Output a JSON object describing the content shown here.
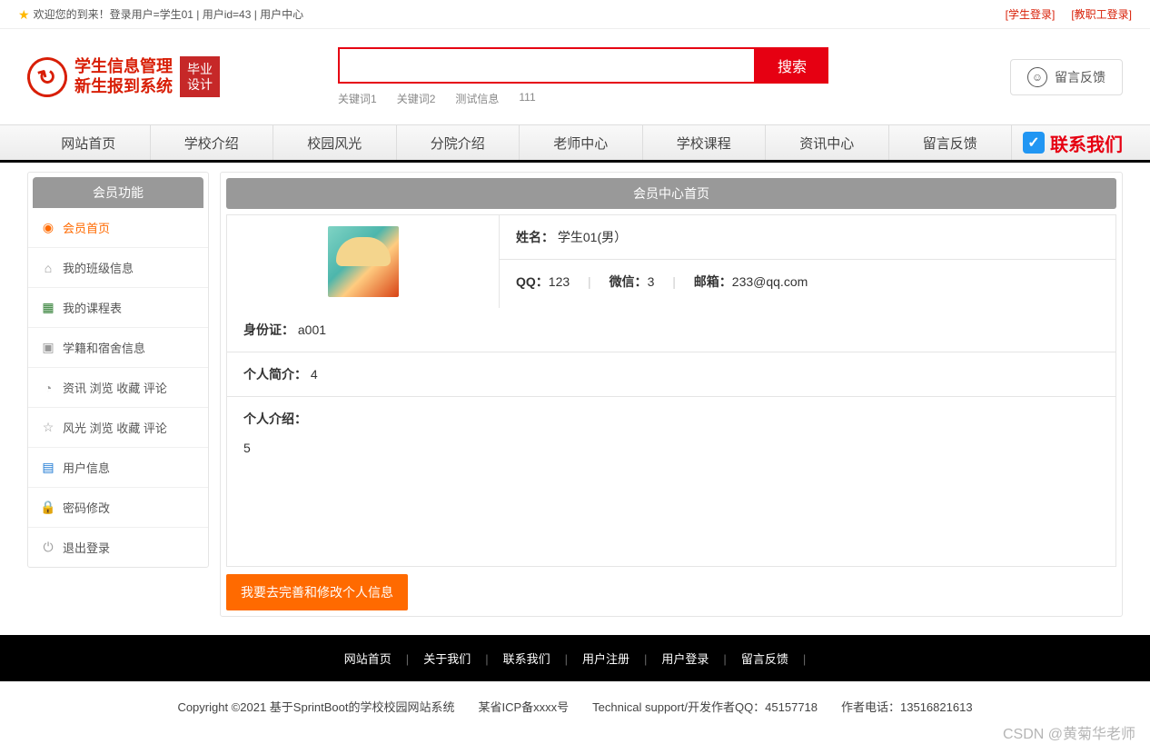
{
  "topbar": {
    "welcome": "欢迎您的到来！登录用户=学生01 | 用户id=43 | 用户中心",
    "student_login": "[学生登录]",
    "staff_login": "[教职工登录]"
  },
  "logo": {
    "line1": "学生信息管理",
    "line2": "新生报到系统",
    "badge_l1": "毕业",
    "badge_l2": "设计"
  },
  "search": {
    "placeholder": "",
    "button": "搜索",
    "keywords": [
      "关键词1",
      "关键词2",
      "测试信息",
      "111"
    ]
  },
  "feedback_btn": "留言反馈",
  "nav": [
    "网站首页",
    "学校介绍",
    "校园风光",
    "分院介绍",
    "老师中心",
    "学校课程",
    "资讯中心",
    "留言反馈"
  ],
  "nav_contact": "联系我们",
  "sidebar": {
    "title": "会员功能",
    "items": [
      {
        "label": "会员首页",
        "icon": "home-icon",
        "color": "ic-orange",
        "glyph": "◉",
        "active": true
      },
      {
        "label": "我的班级信息",
        "icon": "class-icon",
        "color": "ic-gray",
        "glyph": "⌂"
      },
      {
        "label": "我的课程表",
        "icon": "schedule-icon",
        "color": "ic-green",
        "glyph": "▦"
      },
      {
        "label": "学籍和宿舍信息",
        "icon": "dorm-icon",
        "color": "ic-gray",
        "glyph": "▣"
      },
      {
        "label": "资讯 浏览 收藏 评论",
        "icon": "news-icon",
        "color": "ic-gray",
        "glyph": "◔"
      },
      {
        "label": "风光 浏览 收藏 评论",
        "icon": "scenery-icon",
        "color": "ic-gray",
        "glyph": "☆"
      },
      {
        "label": "用户信息",
        "icon": "user-icon",
        "color": "ic-blue",
        "glyph": "▤"
      },
      {
        "label": "密码修改",
        "icon": "password-icon",
        "color": "ic-orange",
        "glyph": "🔒"
      },
      {
        "label": "退出登录",
        "icon": "logout-icon",
        "color": "ic-gray",
        "glyph": "⏻"
      }
    ]
  },
  "content": {
    "title": "会员中心首页",
    "name_label": "姓名：",
    "name_value": "学生01(男）",
    "qq_label": "QQ：",
    "qq_value": "123",
    "wechat_label": "微信：",
    "wechat_value": "3",
    "email_label": "邮箱：",
    "email_value": "233@qq.com",
    "idcard_label": "身份证：",
    "idcard_value": "a001",
    "summary_label": "个人简介：",
    "summary_value": "4",
    "intro_label": "个人介绍：",
    "intro_value": "5",
    "edit_btn": "我要去完善和修改个人信息"
  },
  "footer_nav": [
    "网站首页",
    "关于我们",
    "联系我们",
    "用户注册",
    "用户登录",
    "留言反馈"
  ],
  "footer_copy": "Copyright ©2021 基于SprintBoot的学校校园网站系统　　某省ICP备xxxx号　　Technical support/开发作者QQ：45157718　　作者电话：13516821613",
  "watermark": "CSDN @黄菊华老师"
}
